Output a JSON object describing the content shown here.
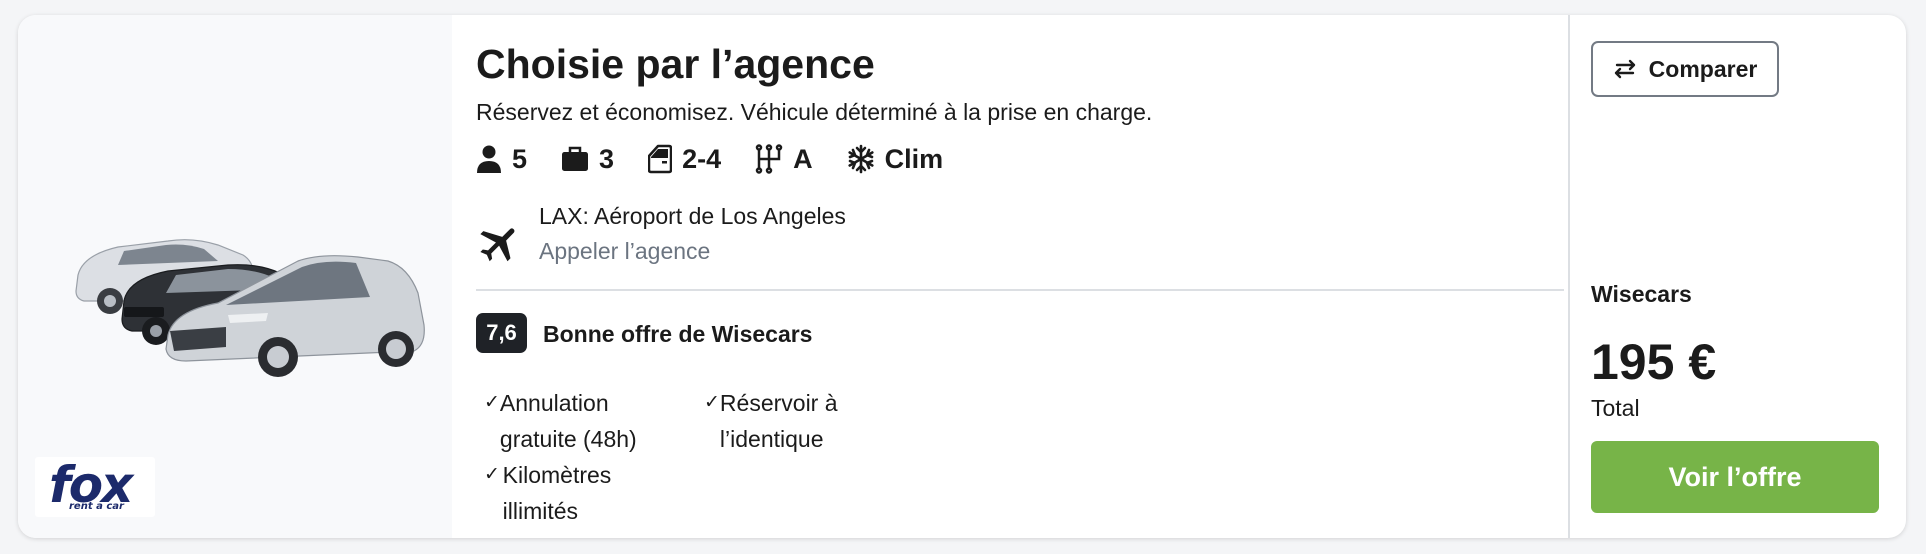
{
  "offer": {
    "title": "Choisie par l’agence",
    "subtitle": "Réservez et économisez. Véhicule déterminé à la prise en charge.",
    "features": [
      {
        "icon": "person-icon",
        "value": "5"
      },
      {
        "icon": "suitcase-icon",
        "value": "3"
      },
      {
        "icon": "car-door-icon",
        "value": "2-4"
      },
      {
        "icon": "gearshift-icon",
        "value": "A"
      },
      {
        "icon": "snowflake-icon",
        "value": "Clim"
      }
    ],
    "location": {
      "icon": "airplane-icon",
      "name": "LAX: Aéroport de Los Angeles",
      "call_label": "Appeler l’agence"
    },
    "rating": {
      "score": "7,6",
      "label": "Bonne offre de Wisecars"
    },
    "perks": [
      {
        "icon": "check-icon",
        "text": "Annulation gratuite (48h)"
      },
      {
        "icon": "check-icon",
        "text": "Réservoir à l’identique"
      },
      {
        "icon": "check-icon",
        "text": "Kilomètres illimités"
      }
    ]
  },
  "agency": {
    "logo_word": "fox",
    "logo_sub": "rent a car"
  },
  "pricing": {
    "compare_label": "Comparer",
    "provider": "Wisecars",
    "price": "195 €",
    "price_caption": "Total",
    "cta_label": "Voir l’offre"
  },
  "colors": {
    "cta": "#77b448",
    "badge": "#1f2227",
    "muted_text": "#6b7480",
    "logo": "#1c2a6b"
  }
}
